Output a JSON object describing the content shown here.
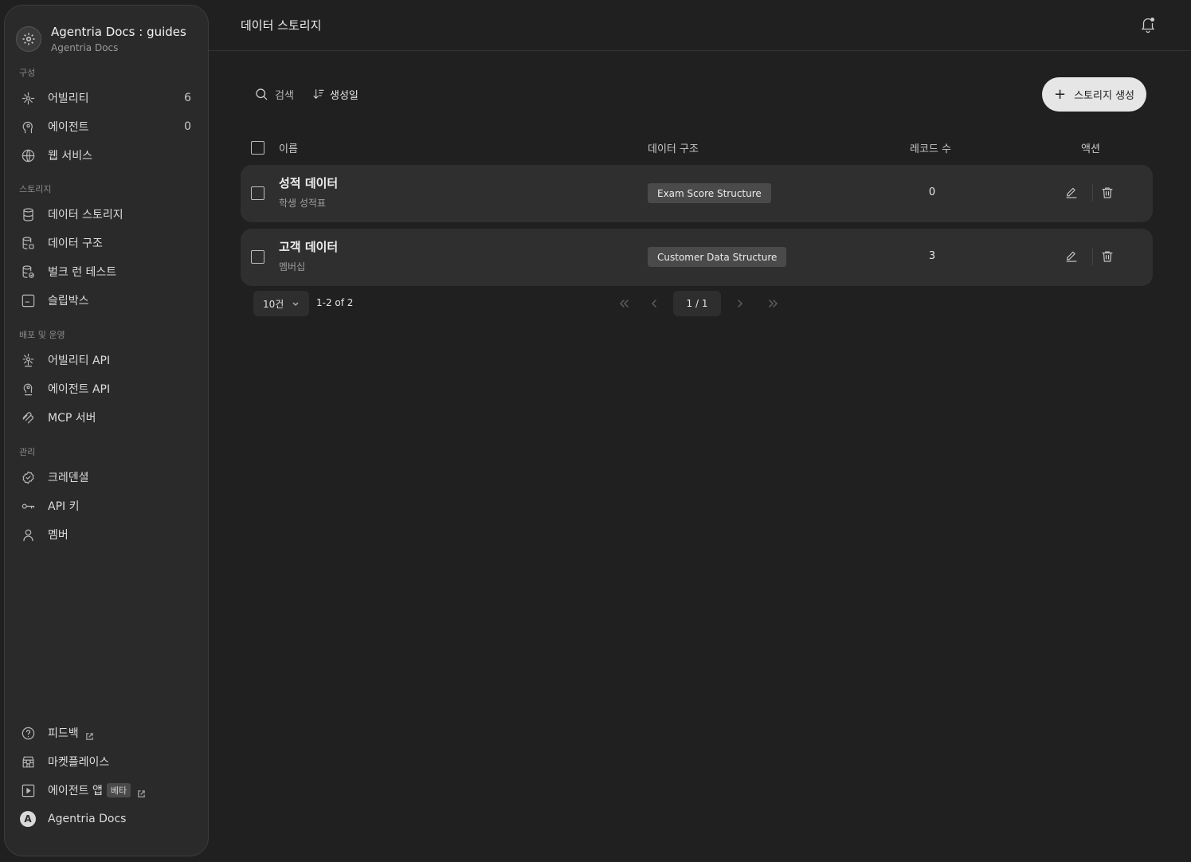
{
  "workspace": {
    "title": "Agentria Docs : guides",
    "subtitle": "Agentria Docs",
    "logo_icon": "gear-icon"
  },
  "sidebar": {
    "sections": [
      {
        "label": "구성"
      },
      {
        "label": "스토리지"
      },
      {
        "label": "배포 및 운영"
      },
      {
        "label": "관리"
      }
    ],
    "items": [
      {
        "label": "어빌리티",
        "count": "6",
        "icon": "ability-icon"
      },
      {
        "label": "에이전트",
        "count": "0",
        "icon": "agent-head-icon"
      },
      {
        "label": "웹 서비스",
        "icon": "globe-icon"
      },
      {
        "label": "데이터 스토리지",
        "icon": "database-icon"
      },
      {
        "label": "데이터 구조",
        "icon": "database-schema-icon"
      },
      {
        "label": "벌크 런 테스트",
        "icon": "database-test-icon"
      },
      {
        "label": "슬립박스",
        "icon": "slipbox-icon"
      },
      {
        "label": "어빌리티 API",
        "icon": "ability-api-icon"
      },
      {
        "label": "에이전트 API",
        "icon": "agent-api-icon"
      },
      {
        "label": "MCP 서버",
        "icon": "mcp-icon"
      },
      {
        "label": "크레덴셜",
        "icon": "badge-check-icon"
      },
      {
        "label": "API 키",
        "icon": "key-icon"
      },
      {
        "label": "멤버",
        "icon": "user-icon"
      }
    ],
    "footer": [
      {
        "label": "피드백",
        "icon": "help-circle-icon"
      },
      {
        "label": "마켓플레이스",
        "icon": "store-icon"
      },
      {
        "label": "에이전트 앱",
        "badge": "베타",
        "icon": "play-square-icon"
      },
      {
        "label": "Agentria Docs",
        "avatar": "A"
      }
    ]
  },
  "header": {
    "title": "데이터 스토리지",
    "bell_icon": "bell-icon"
  },
  "toolbar": {
    "search_label": "검색",
    "sort_label": "생성일",
    "create_label": "스토리지 생성"
  },
  "table": {
    "columns": [
      "이름",
      "데이터 구조",
      "레코드 수",
      "액션"
    ],
    "rows": [
      {
        "name": "성적 데이터",
        "description": "학생 성적표",
        "structure": "Exam Score Structure",
        "records": "0"
      },
      {
        "name": "고객 데이터",
        "description": "멤버십",
        "structure": "Customer Data Structure",
        "records": "3"
      }
    ]
  },
  "pagination": {
    "page_size": "10건",
    "range": "1-2 of 2",
    "current": "1 / 1"
  }
}
